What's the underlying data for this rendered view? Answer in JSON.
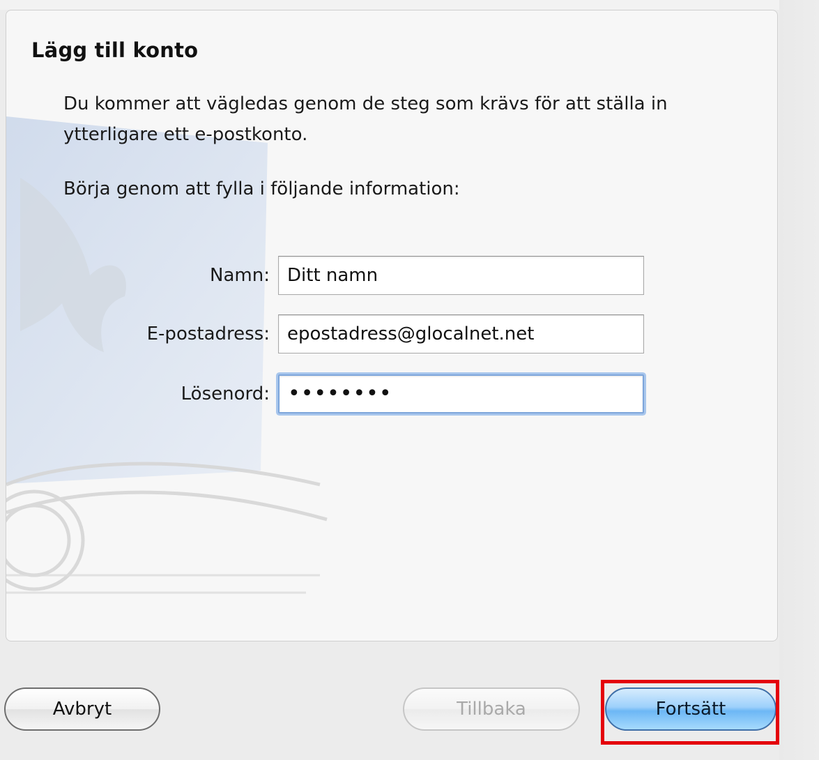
{
  "dialog": {
    "title": "Lägg till konto",
    "intro": "Du kommer att vägledas genom de steg som krävs för att ställa in ytterligare ett e-postkonto.",
    "instruction": "Börja genom att fylla i följande information:"
  },
  "form": {
    "name_label": "Namn:",
    "name_value": "Ditt namn",
    "email_label": "E-postadress:",
    "email_value": "epostadress@glocalnet.net",
    "password_label": "Lösenord:",
    "password_value": "••••••••"
  },
  "buttons": {
    "cancel_label": "Avbryt",
    "back_label": "Tillbaka",
    "continue_label": "Fortsätt"
  },
  "colors": {
    "highlight": "#e4000b",
    "primary_button": "#7fbff7",
    "focus_ring": "#a8c6ec"
  },
  "icons": {
    "background_image": "mail-stamp-eagle-icon"
  }
}
